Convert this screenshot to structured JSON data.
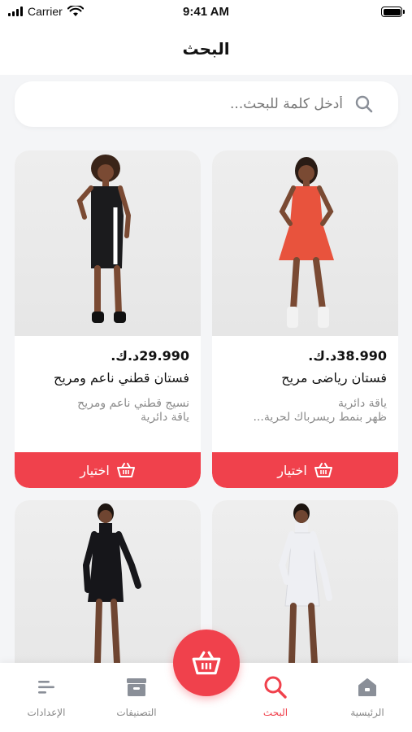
{
  "status_bar": {
    "carrier": "Carrier",
    "time": "9:41 AM"
  },
  "header": {
    "title": "البحث"
  },
  "search": {
    "placeholder": "أدخل كلمة للبحث..."
  },
  "products": [
    {
      "price": "38.990د.ك.",
      "name": "فستان رياضى مريح",
      "desc_line1": "ياقة دائرية",
      "desc_line2": "ظهر بنمط ريسرباك لحرية...",
      "button": "اختيار",
      "dress_color": "#e8533d"
    },
    {
      "price": "29.990د.ك.",
      "name": "فستان قطني ناعم ومريح",
      "desc_line1": "نسيج قطني ناعم ومريح",
      "desc_line2": "ياقة دائرية",
      "button": "اختيار",
      "dress_color": "#1b1b1d"
    },
    {
      "dress_color": "#eeeff3"
    },
    {
      "dress_color": "#16161a"
    }
  ],
  "nav": {
    "home": "الرئيسية",
    "search": "البحث",
    "categories": "التصنيفات",
    "settings": "الإعدادات"
  },
  "colors": {
    "accent": "#f0414c",
    "inactive": "#888888"
  }
}
